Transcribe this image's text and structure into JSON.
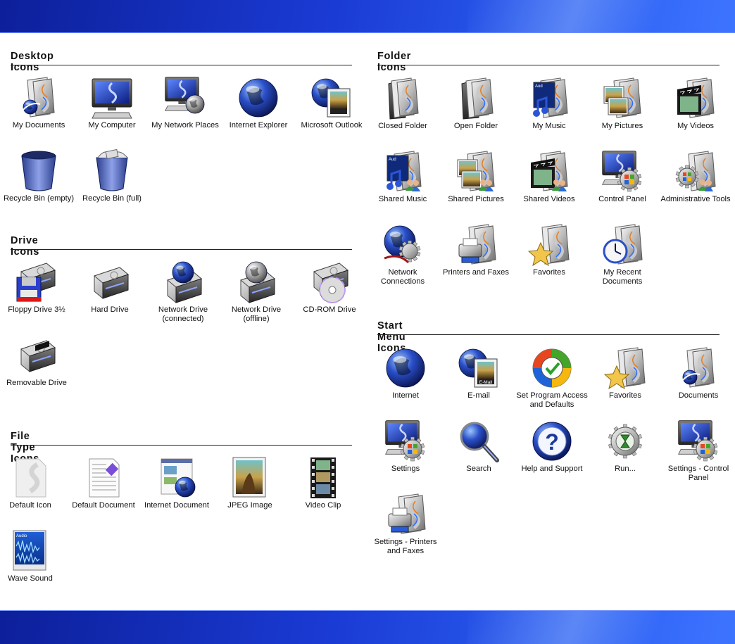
{
  "sections": {
    "desktop": {
      "title": "Desktop Icons",
      "items": [
        {
          "label": "My Documents",
          "icon": "my-documents-icon"
        },
        {
          "label": "My Computer",
          "icon": "my-computer-icon"
        },
        {
          "label": "My Network Places",
          "icon": "my-network-places-icon"
        },
        {
          "label": "Internet Explorer",
          "icon": "internet-explorer-icon"
        },
        {
          "label": "Microsoft Outlook",
          "icon": "microsoft-outlook-icon"
        },
        {
          "label": "Recycle Bin (empty)",
          "icon": "recycle-bin-empty-icon"
        },
        {
          "label": "Recycle Bin (full)",
          "icon": "recycle-bin-full-icon"
        }
      ]
    },
    "drive": {
      "title": "Drive Icons",
      "items": [
        {
          "label": "Floppy Drive 3½",
          "icon": "floppy-drive-icon"
        },
        {
          "label": "Hard Drive",
          "icon": "hard-drive-icon"
        },
        {
          "label": "Network Drive (connected)",
          "icon": "network-drive-connected-icon"
        },
        {
          "label": "Network Drive (offline)",
          "icon": "network-drive-offline-icon"
        },
        {
          "label": "CD-ROM Drive",
          "icon": "cdrom-drive-icon"
        },
        {
          "label": "Removable Drive",
          "icon": "removable-drive-icon"
        }
      ]
    },
    "filetype": {
      "title": "File Type Icons",
      "items": [
        {
          "label": "Default Icon",
          "icon": "default-file-icon"
        },
        {
          "label": "Default Document",
          "icon": "default-document-icon"
        },
        {
          "label": "Internet Document",
          "icon": "internet-document-icon"
        },
        {
          "label": "JPEG Image",
          "icon": "jpeg-image-icon"
        },
        {
          "label": "Video Clip",
          "icon": "video-clip-icon"
        },
        {
          "label": "Wave Sound",
          "icon": "wave-sound-icon",
          "art_text": "Audio"
        }
      ]
    },
    "folder": {
      "title": "Folder Icons",
      "items": [
        {
          "label": "Closed Folder",
          "icon": "closed-folder-icon"
        },
        {
          "label": "Open Folder",
          "icon": "open-folder-icon"
        },
        {
          "label": "My Music",
          "icon": "my-music-icon"
        },
        {
          "label": "My Pictures",
          "icon": "my-pictures-icon"
        },
        {
          "label": "My Videos",
          "icon": "my-videos-icon"
        },
        {
          "label": "Shared Music",
          "icon": "shared-music-icon"
        },
        {
          "label": "Shared Pictures",
          "icon": "shared-pictures-icon"
        },
        {
          "label": "Shared Videos",
          "icon": "shared-videos-icon"
        },
        {
          "label": "Control Panel",
          "icon": "control-panel-icon"
        },
        {
          "label": "Administrative Tools",
          "icon": "administrative-tools-icon"
        },
        {
          "label": "Network Connections",
          "icon": "network-connections-icon"
        },
        {
          "label": "Printers and Faxes",
          "icon": "printers-faxes-icon"
        },
        {
          "label": "Favorites",
          "icon": "favorites-icon"
        },
        {
          "label": "My Recent Documents",
          "icon": "recent-documents-icon"
        }
      ]
    },
    "start": {
      "title": "Start Menu Icons",
      "items": [
        {
          "label": "Internet",
          "icon": "internet-icon"
        },
        {
          "label": "E-mail",
          "icon": "email-icon",
          "art_text": "E-Mail"
        },
        {
          "label": "Set Program Access and Defaults",
          "icon": "program-access-icon"
        },
        {
          "label": "Favorites",
          "icon": "favorites-icon"
        },
        {
          "label": "Documents",
          "icon": "documents-icon"
        },
        {
          "label": "Settings",
          "icon": "settings-icon"
        },
        {
          "label": "Search",
          "icon": "search-icon"
        },
        {
          "label": "Help and Support",
          "icon": "help-support-icon",
          "art_text": "?"
        },
        {
          "label": "Run...",
          "icon": "run-icon"
        },
        {
          "label": "Settings - Control Panel",
          "icon": "settings-control-panel-icon"
        },
        {
          "label": "Settings - Printers and Faxes",
          "icon": "settings-printers-icon"
        }
      ]
    }
  },
  "colors": {
    "band_dark": "#0d1f9a",
    "band_light": "#3d74ff",
    "text": "#111111",
    "rule": "#222222"
  }
}
